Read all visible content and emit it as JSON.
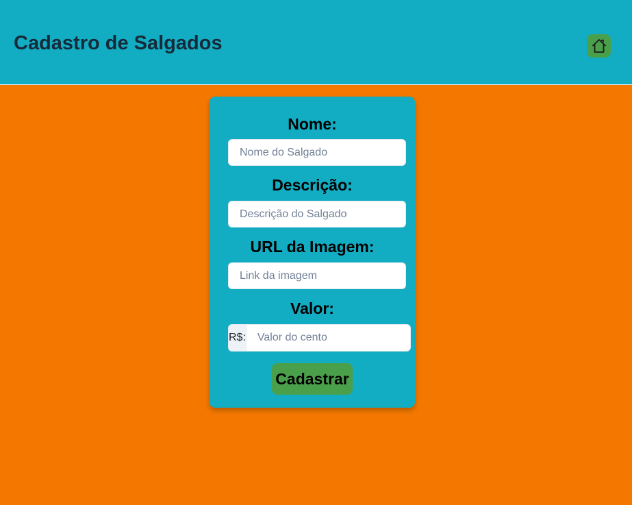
{
  "header": {
    "title": "Cadastro de Salgados",
    "home_icon": "home-icon"
  },
  "form": {
    "nome": {
      "label": "Nome:",
      "placeholder": "Nome do Salgado",
      "value": ""
    },
    "descricao": {
      "label": "Descrição:",
      "placeholder": "Descrição do Salgado",
      "value": ""
    },
    "imagem": {
      "label": "URL da Imagem:",
      "placeholder": "Link da imagem",
      "value": ""
    },
    "valor": {
      "label": "Valor:",
      "addon": "R$:",
      "placeholder": "Valor do cento",
      "value": ""
    },
    "submit_label": "Cadastrar"
  },
  "colors": {
    "page_background": "#f47800",
    "header_background": "#13adc3",
    "card_background": "#13adc3",
    "button_background": "#4aa04a",
    "title_color": "#172a3a"
  }
}
